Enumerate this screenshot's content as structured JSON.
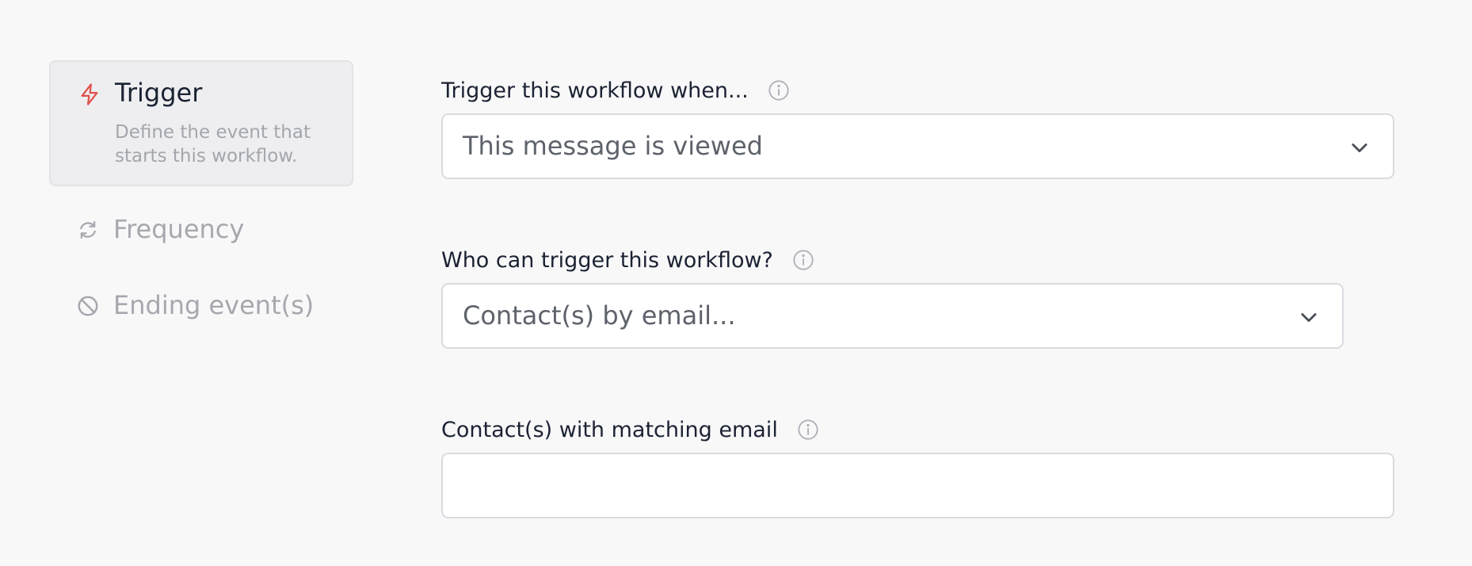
{
  "sidebar": {
    "steps": [
      {
        "title": "Trigger",
        "description": "Define the event that starts this workflow.",
        "icon": "lightning-icon",
        "active": true
      },
      {
        "title": "Frequency",
        "icon": "refresh-icon",
        "active": false
      },
      {
        "title": "Ending event(s)",
        "icon": "ban-icon",
        "active": false
      }
    ]
  },
  "form": {
    "trigger_event": {
      "label": "Trigger this workflow when...",
      "value": "This message is viewed"
    },
    "who_can_trigger": {
      "label": "Who can trigger this workflow?",
      "value": "Contact(s) by email..."
    },
    "matching_email": {
      "label": "Contact(s) with matching email",
      "value": ""
    }
  },
  "colors": {
    "background": "#f8f8f9",
    "accent_red": "#e0524d",
    "active_step_bg": "#eeeef0",
    "muted_text": "#a6a8ae",
    "border": "#d9dbe0"
  }
}
